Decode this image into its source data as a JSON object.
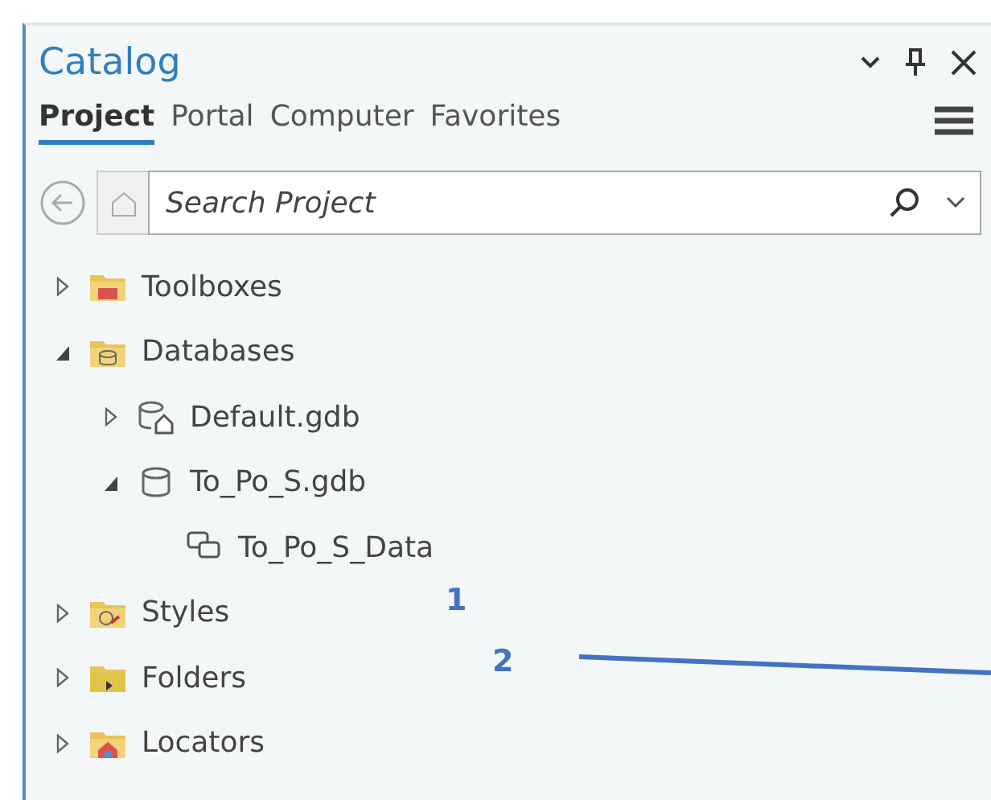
{
  "pane": {
    "title": "Catalog"
  },
  "tabs": [
    {
      "label": "Project",
      "selected": true
    },
    {
      "label": "Portal",
      "selected": false
    },
    {
      "label": "Computer",
      "selected": false
    },
    {
      "label": "Favorites",
      "selected": false
    }
  ],
  "search": {
    "placeholder": "Search Project"
  },
  "tree": [
    {
      "label": "Toolboxes",
      "kind": "toolbox",
      "expanded": false
    },
    {
      "label": "Databases",
      "kind": "dbfolder",
      "expanded": true,
      "children": [
        {
          "label": "Default.gdb",
          "kind": "homedb",
          "expanded": false
        },
        {
          "label": "To_Po_S.gdb",
          "kind": "db",
          "expanded": true,
          "children": [
            {
              "label": "To_Po_S_Data",
              "kind": "dataset"
            }
          ]
        }
      ]
    },
    {
      "label": "Styles",
      "kind": "styles",
      "expanded": false
    },
    {
      "label": "Folders",
      "kind": "folder",
      "expanded": false
    },
    {
      "label": "Locators",
      "kind": "locator",
      "expanded": false
    }
  ],
  "annotations": [
    {
      "label": "1"
    },
    {
      "label": "2"
    }
  ]
}
